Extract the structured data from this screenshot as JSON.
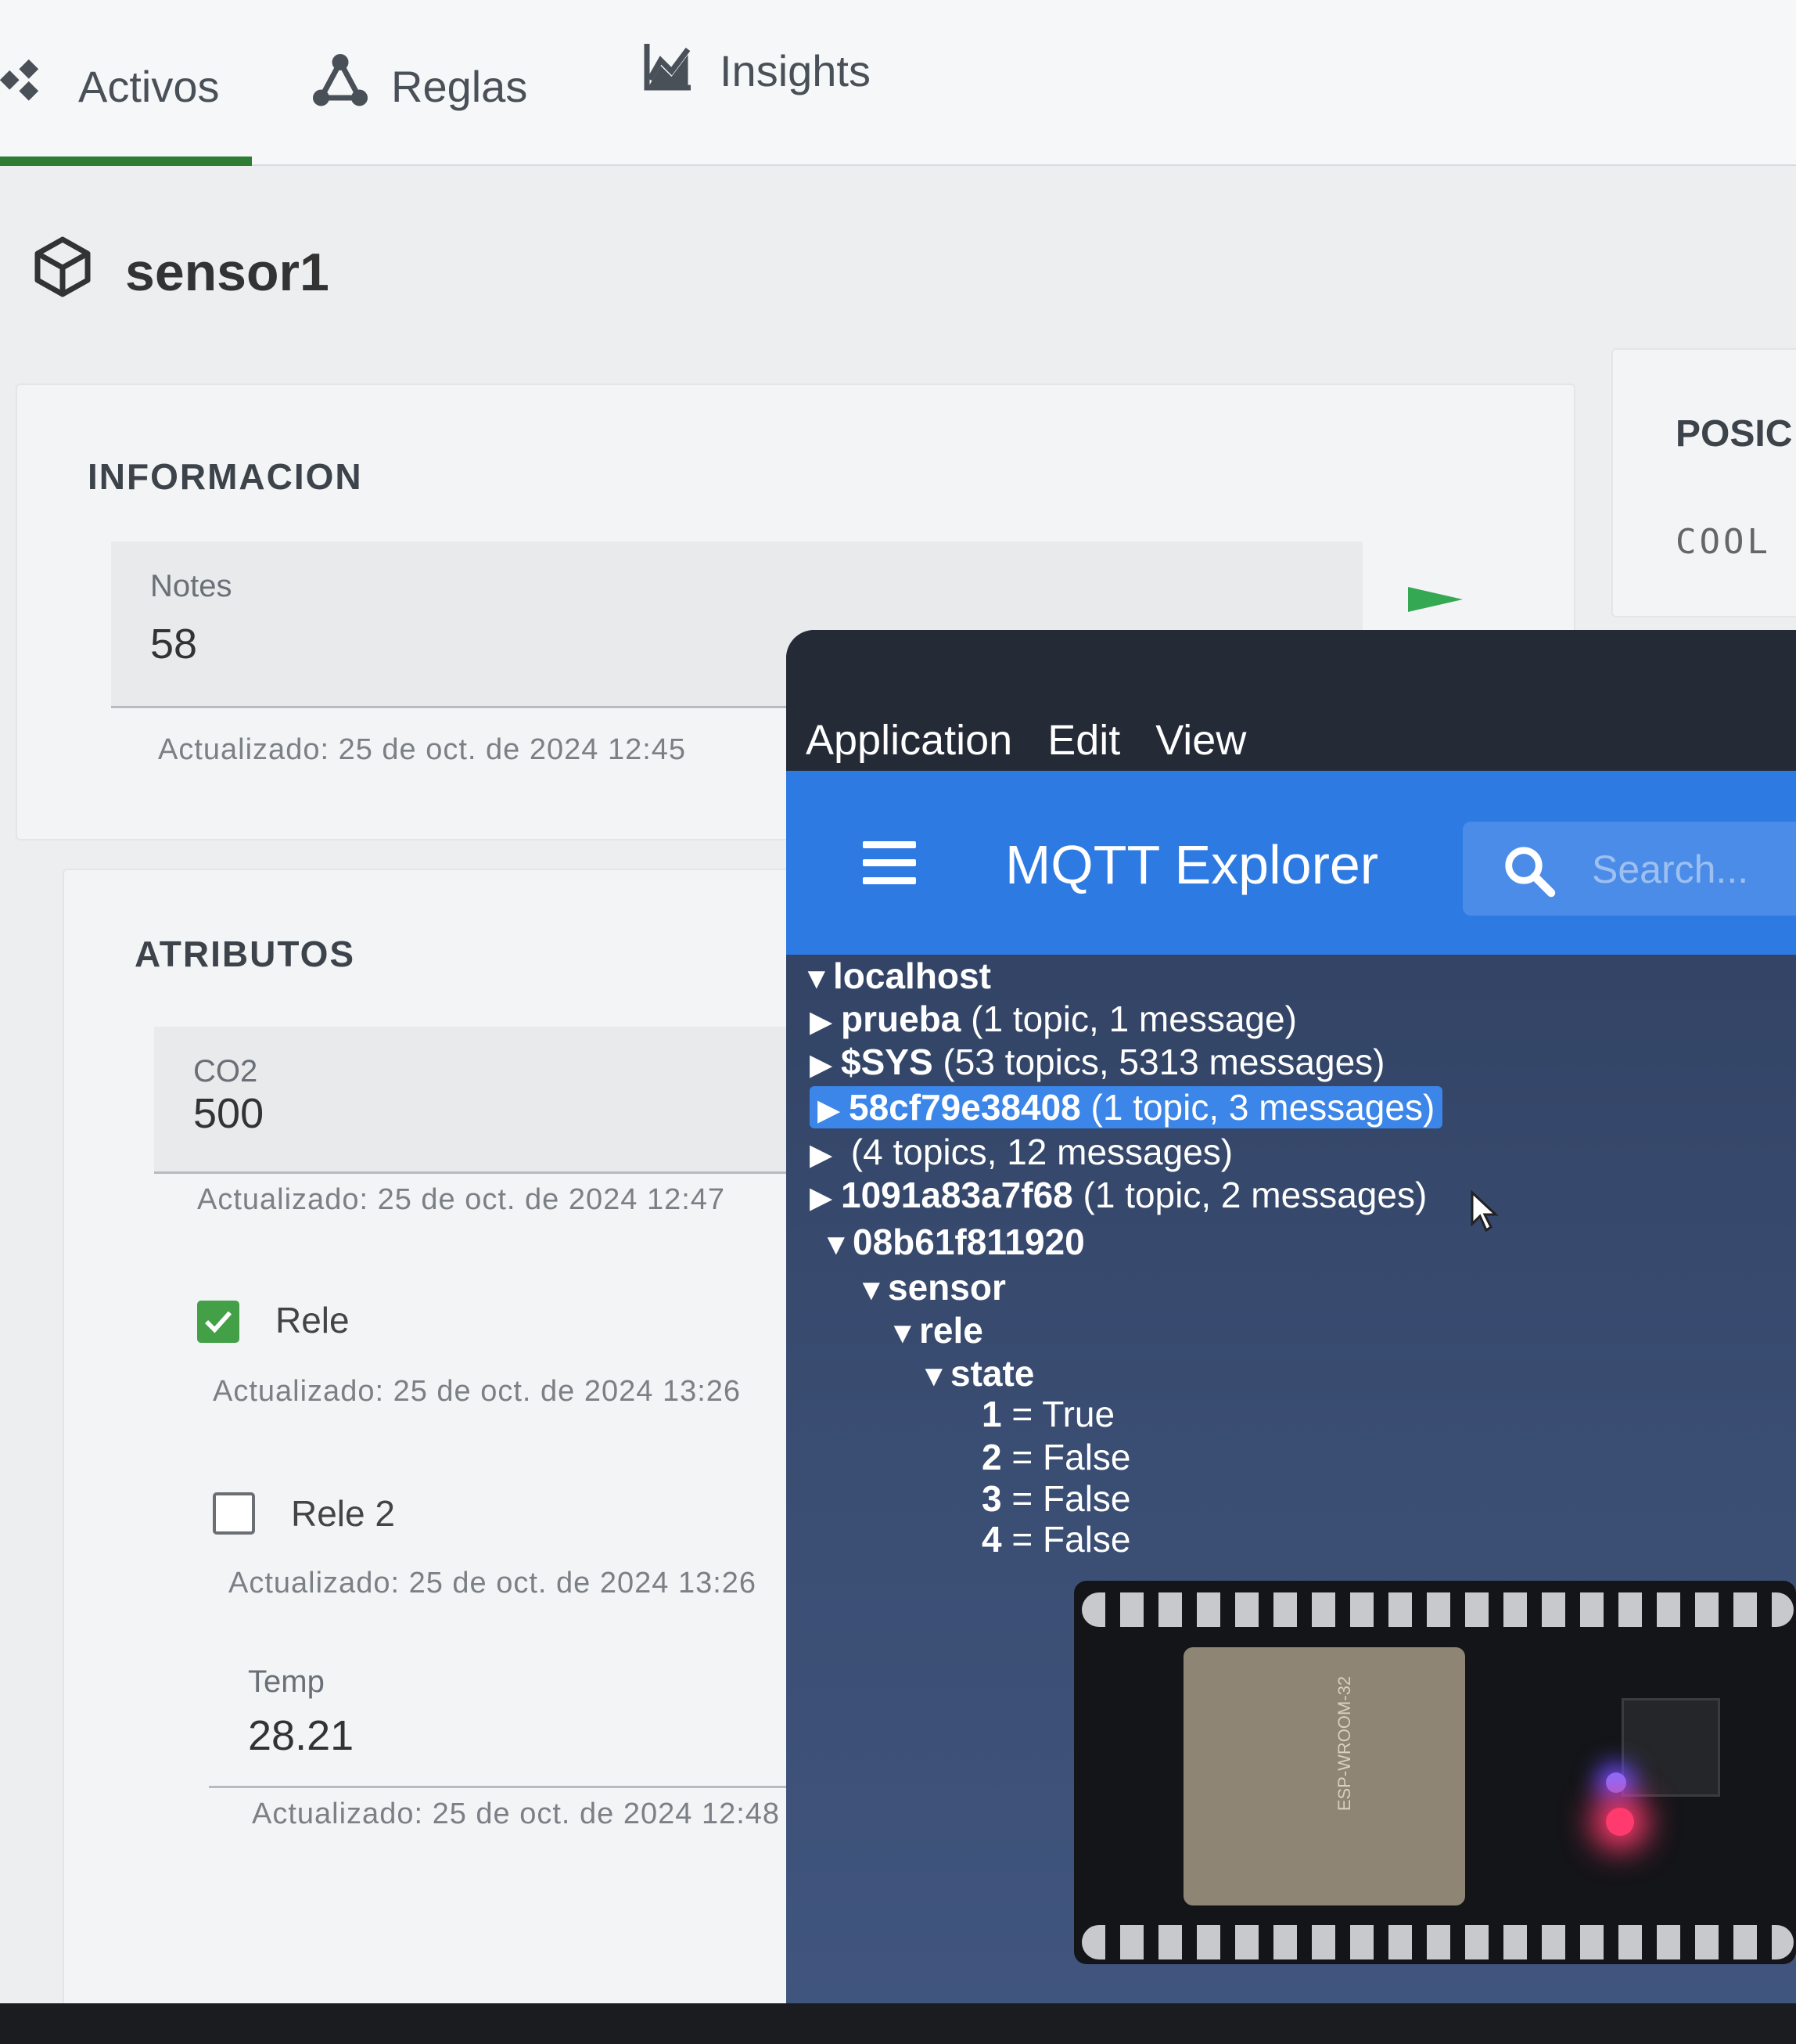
{
  "tabs": [
    {
      "label": "Activos",
      "icon": "assets-icon"
    },
    {
      "label": "Reglas",
      "icon": "rules-icon"
    },
    {
      "label": "Insights",
      "icon": "insights-chart-icon"
    }
  ],
  "page": {
    "title": "sensor1",
    "icon": "cube-icon"
  },
  "informacion": {
    "title": "INFORMACION",
    "notes_label": "Notes",
    "notes_value": "58",
    "notes_updated": "Actualizado: 25 de oct. de 2024 12:45"
  },
  "posicion": {
    "title": "POSIC",
    "map_text": "COOL"
  },
  "atributos": {
    "title": "ATRIBUTOS",
    "co2_label": "CO2",
    "co2_value": "500",
    "co2_updated": "Actualizado: 25 de oct. de 2024 12:47",
    "rele_label": "Rele",
    "rele_checked": true,
    "rele_updated": "Actualizado: 25 de oct. de 2024 13:26",
    "rele2_label": "Rele 2",
    "rele2_checked": false,
    "rele2_updated": "Actualizado: 25 de oct. de 2024 13:26",
    "temp_label": "Temp",
    "temp_value": "28.21",
    "temp_updated": "Actualizado: 25 de oct. de 2024 12:48"
  },
  "mqtt": {
    "menu": [
      "Application",
      "Edit",
      "View"
    ],
    "app_name": "MQTT Explorer",
    "search_placeholder": "Search...",
    "tree": [
      {
        "arrow": "▼",
        "name": "localhost",
        "meta": ""
      },
      {
        "arrow": "▶",
        "name": "prueba",
        "meta": "(1 topic, 1 message)"
      },
      {
        "arrow": "▶",
        "name": "$SYS",
        "meta": "(53 topics, 5313 messages)"
      },
      {
        "arrow": "▶",
        "name": "58cf79e38408",
        "meta": "(1 topic, 3 messages)"
      },
      {
        "arrow": "▶",
        "name": "",
        "meta": "(4 topics, 12 messages)"
      },
      {
        "arrow": "▶",
        "name": "1091a83a7f68",
        "meta": "(1 topic, 2 messages)"
      },
      {
        "arrow": "▼",
        "name": "08b61f811920",
        "meta": ""
      },
      {
        "arrow": "▼",
        "name": "sensor",
        "meta": ""
      },
      {
        "arrow": "▼",
        "name": "rele",
        "meta": ""
      },
      {
        "arrow": "▼",
        "name": "state",
        "meta": ""
      },
      {
        "arrow": "",
        "name": "1",
        "meta": "= True"
      },
      {
        "arrow": "",
        "name": "2",
        "meta": "= False"
      },
      {
        "arrow": "",
        "name": "3",
        "meta": "= False"
      },
      {
        "arrow": "",
        "name": "4",
        "meta": "= False"
      }
    ],
    "selected_index": 3
  },
  "colors": {
    "accent_green": "#2e7d32",
    "mqtt_blue": "#2e7ae3",
    "checkbox_green": "#43a047"
  }
}
